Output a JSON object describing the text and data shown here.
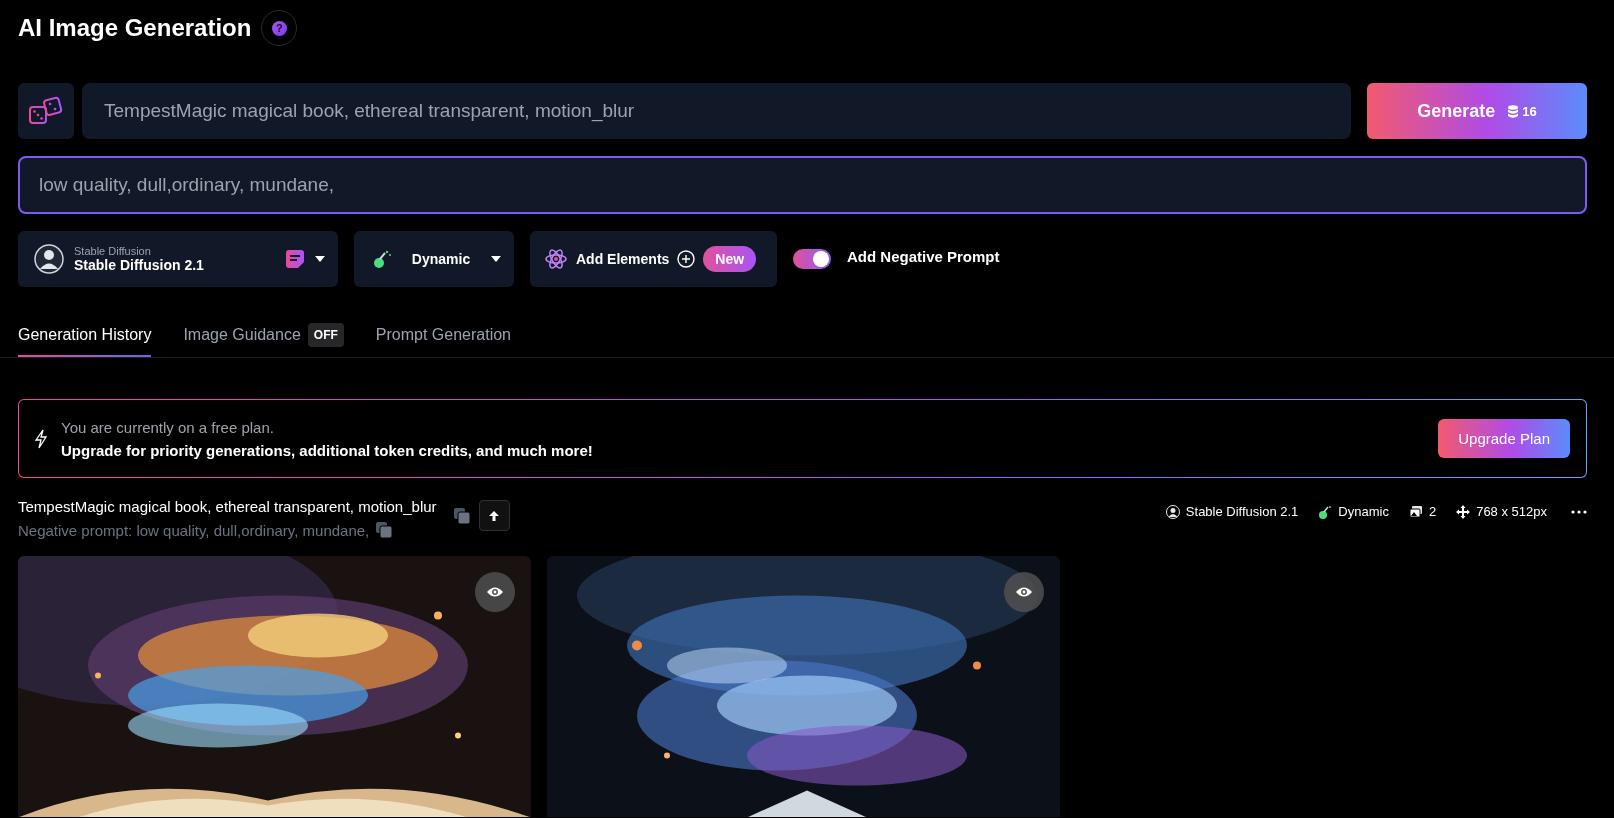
{
  "header": {
    "title": "AI Image Generation",
    "help": "?"
  },
  "prompt": {
    "value": "TempestMagic magical book, ethereal transparent, motion_blur"
  },
  "generate_button": {
    "label": "Generate",
    "credits": "16"
  },
  "negative_prompt": {
    "value": "low quality, dull,ordinary, mundane,",
    "focused": true
  },
  "model_select": {
    "caption": "Stable Diffusion",
    "value": "Stable Diffusion 2.1"
  },
  "style_select": {
    "value": "Dynamic"
  },
  "add_elements": {
    "label": "Add Elements",
    "badge": "New"
  },
  "negative_toggle": {
    "label": "Add Negative Prompt",
    "on": true
  },
  "tabs": [
    {
      "label": "Generation History",
      "selected": true
    },
    {
      "label": "Image Guidance",
      "badge": "OFF",
      "selected": false
    },
    {
      "label": "Prompt Generation",
      "selected": false
    }
  ],
  "banner": {
    "line_1": "You are currently on a free plan.",
    "line_2": "Upgrade for priority generations, additional token credits, and much more!",
    "button": "Upgrade Plan"
  },
  "generation": {
    "prompt": "TempestMagic magical book, ethereal transparent, motion_blur",
    "negative_prompt": "Negative prompt: low quality, dull,ordinary, mundane,",
    "meta": [
      {
        "kind": "model",
        "text": "Stable Diffusion 2.1"
      },
      {
        "kind": "style",
        "text": "Dynamic"
      },
      {
        "kind": "count",
        "text": "2"
      },
      {
        "kind": "size",
        "text": "768 x 512px"
      }
    ]
  }
}
